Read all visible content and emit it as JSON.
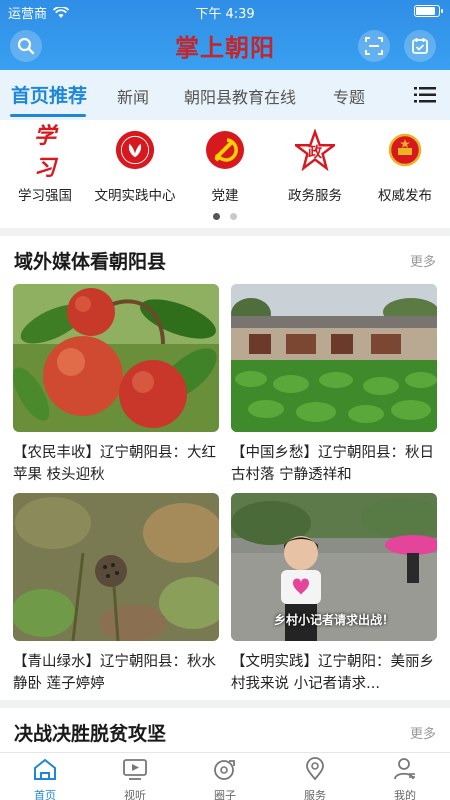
{
  "status_bar": {
    "carrier": "运营商",
    "time": "下午 4:39",
    "battery_level": 0.9
  },
  "header": {
    "logo_text": "掌上朝阳"
  },
  "tabs": [
    {
      "label": "首页推荐",
      "active": true
    },
    {
      "label": "新闻",
      "active": false
    },
    {
      "label": "朝阳县教育在线",
      "active": false
    },
    {
      "label": "专题",
      "active": false
    }
  ],
  "quick_entries": [
    {
      "label": "学习强国",
      "icon": "xuexi-logo-icon",
      "icon_text": "学习"
    },
    {
      "label": "文明实践中心",
      "icon": "civilization-center-icon",
      "icon_text": ""
    },
    {
      "label": "党建",
      "icon": "party-emblem-icon",
      "icon_text": ""
    },
    {
      "label": "政务服务",
      "icon": "government-star-icon",
      "icon_text": "政"
    },
    {
      "label": "权威发布",
      "icon": "national-emblem-icon",
      "icon_text": ""
    }
  ],
  "pager": {
    "pages": 2,
    "current": 1
  },
  "section1": {
    "title": "域外媒体看朝阳县",
    "more": "更多",
    "cards": [
      {
        "text": "【农民丰收】辽宁朝阳县：大红苹果 枝头迎秋",
        "image": "red apples on branch"
      },
      {
        "text": "【中国乡愁】辽宁朝阳县：秋日古村落 宁静透祥和",
        "image": "old village house with crops"
      },
      {
        "text": "【青山绿水】辽宁朝阳县：秋水静卧 莲子婷婷",
        "image": "lotus pond with seed pod"
      },
      {
        "text": "【文明实践】辽宁朝阳：美丽乡村我来说 小记者请求...",
        "image": "girl in village road",
        "caption": "乡村小记者请求出战！"
      }
    ]
  },
  "section2": {
    "title": "决战决胜脱贫攻坚",
    "more": "更多"
  },
  "bottom_nav": [
    {
      "label": "首页",
      "icon": "home-icon",
      "active": true
    },
    {
      "label": "视听",
      "icon": "tv-icon",
      "active": false
    },
    {
      "label": "圈子",
      "icon": "circle-icon",
      "active": false
    },
    {
      "label": "服务",
      "icon": "location-pin-icon",
      "active": false
    },
    {
      "label": "我的",
      "icon": "user-icon",
      "active": false
    }
  ],
  "colors": {
    "primary": "#1f87db",
    "header": "#3aa0f0",
    "logo": "#c1272d",
    "party_red": "#d7191f"
  }
}
